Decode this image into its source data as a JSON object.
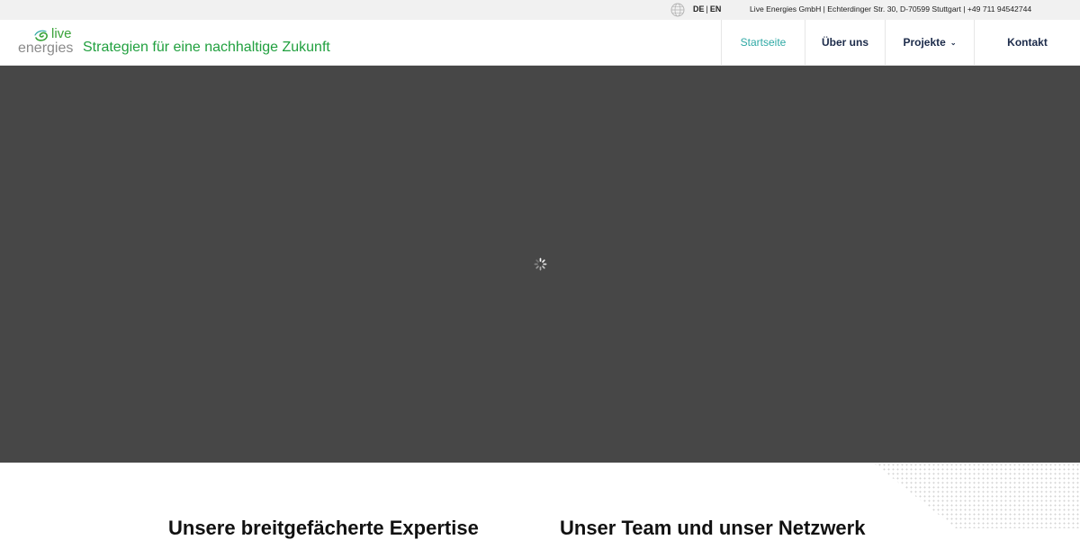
{
  "topbar": {
    "lang_de": "DE",
    "lang_sep": "|",
    "lang_en": "EN",
    "contact": "Live Energies GmbH | Echterdinger Str. 30, D-70599 Stuttgart | +49 711 94542744",
    "globe_icon": "globe-icon"
  },
  "header": {
    "logo_live": "live",
    "logo_energies": "energies",
    "tagline": "Strategien für eine nachhaltige Zukunft"
  },
  "nav": {
    "items": [
      {
        "label": "Startseite",
        "active": true
      },
      {
        "label": "Über uns",
        "active": false
      },
      {
        "label": "Projekte",
        "active": false,
        "has_dropdown": true
      },
      {
        "label": "Kontakt",
        "active": false
      }
    ]
  },
  "hero": {
    "loading_icon": "spinner-icon"
  },
  "sections": {
    "left_title": "Unsere breitgefächerte Expertise",
    "right_title": "Unser Team und unser Netzwerk"
  },
  "colors": {
    "brand_green": "#21a03f",
    "active_teal": "#2fa9a5",
    "nav_text": "#1c2b4a",
    "hero_bg": "#474747"
  }
}
